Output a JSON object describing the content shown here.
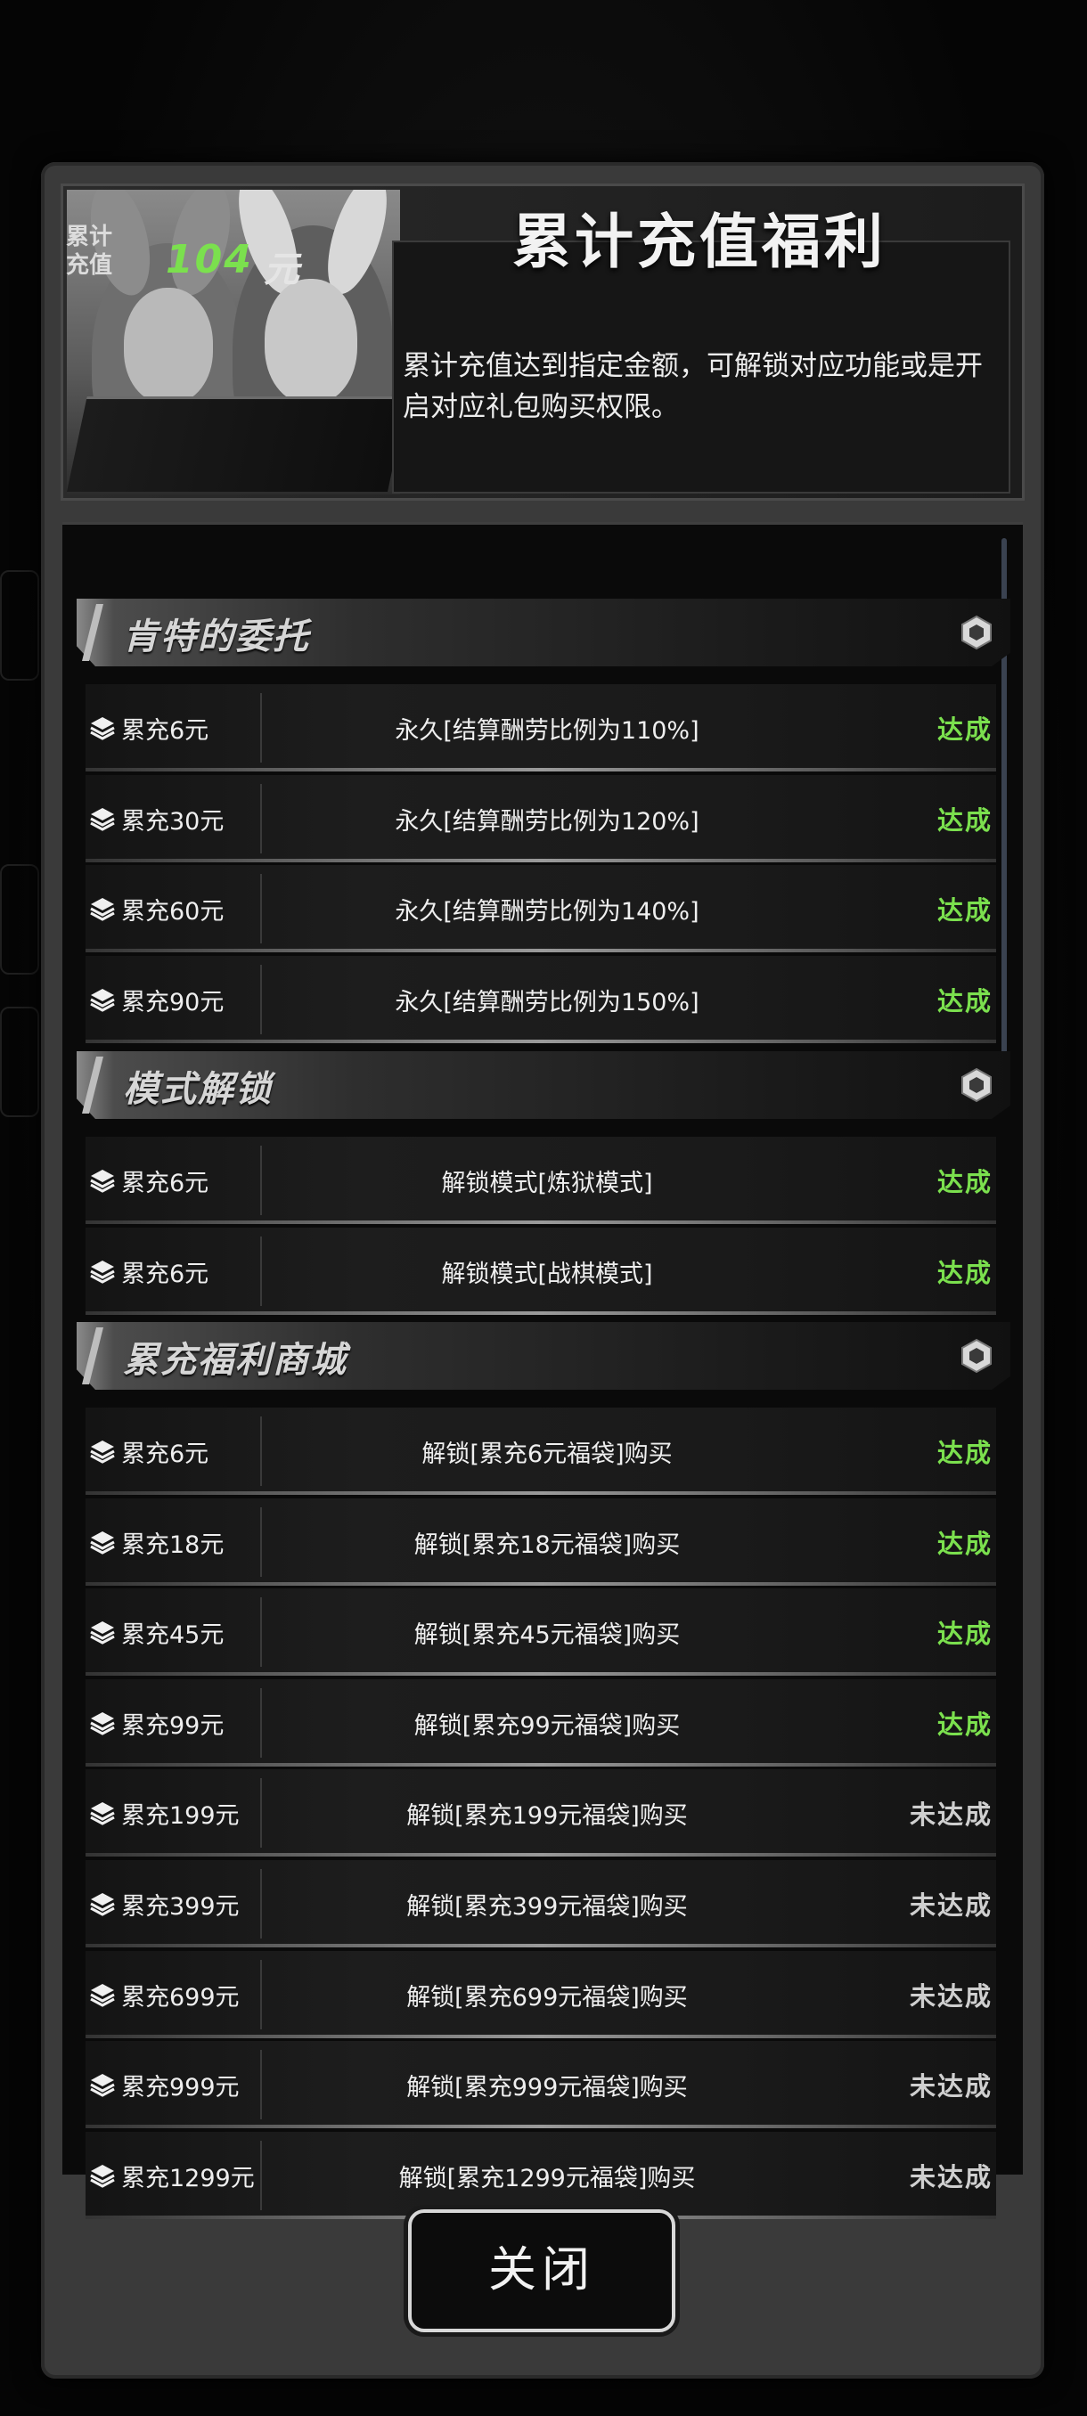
{
  "header": {
    "title": "累计充值福利",
    "description": "累计充值达到指定金额，可解锁对应功能或是开启对应礼包购买权限。",
    "stat_label_line1": "累计",
    "stat_label_line2": "充值",
    "stat_value": "104",
    "stat_unit": "元"
  },
  "sections": [
    {
      "title": "肯特的委托",
      "rows": [
        {
          "amount": "累充6元",
          "desc": "永久[结算酬劳比例为110%]",
          "status": "达成"
        },
        {
          "amount": "累充30元",
          "desc": "永久[结算酬劳比例为120%]",
          "status": "达成"
        },
        {
          "amount": "累充60元",
          "desc": "永久[结算酬劳比例为140%]",
          "status": "达成"
        },
        {
          "amount": "累充90元",
          "desc": "永久[结算酬劳比例为150%]",
          "status": "达成"
        }
      ]
    },
    {
      "title": "模式解锁",
      "rows": [
        {
          "amount": "累充6元",
          "desc": "解锁模式[炼狱模式]",
          "status": "达成"
        },
        {
          "amount": "累充6元",
          "desc": "解锁模式[战棋模式]",
          "status": "达成"
        }
      ]
    },
    {
      "title": "累充福利商城",
      "rows": [
        {
          "amount": "累充6元",
          "desc": "解锁[累充6元福袋]购买",
          "status": "达成"
        },
        {
          "amount": "累充18元",
          "desc": "解锁[累充18元福袋]购买",
          "status": "达成"
        },
        {
          "amount": "累充45元",
          "desc": "解锁[累充45元福袋]购买",
          "status": "达成"
        },
        {
          "amount": "累充99元",
          "desc": "解锁[累充99元福袋]购买",
          "status": "达成"
        },
        {
          "amount": "累充199元",
          "desc": "解锁[累充199元福袋]购买",
          "status": "未达成"
        },
        {
          "amount": "累充399元",
          "desc": "解锁[累充399元福袋]购买",
          "status": "未达成"
        },
        {
          "amount": "累充699元",
          "desc": "解锁[累充699元福袋]购买",
          "status": "未达成"
        },
        {
          "amount": "累充999元",
          "desc": "解锁[累充999元福袋]购买",
          "status": "未达成"
        },
        {
          "amount": "累充1299元",
          "desc": "解锁[累充1299元福袋]购买",
          "status": "未达成"
        }
      ]
    }
  ],
  "close_label": "关闭",
  "icons": {
    "row": "layers-icon",
    "section": "hexagon-icon"
  },
  "colors": {
    "done": "#7be04e",
    "pending": "#cfcfcf"
  }
}
